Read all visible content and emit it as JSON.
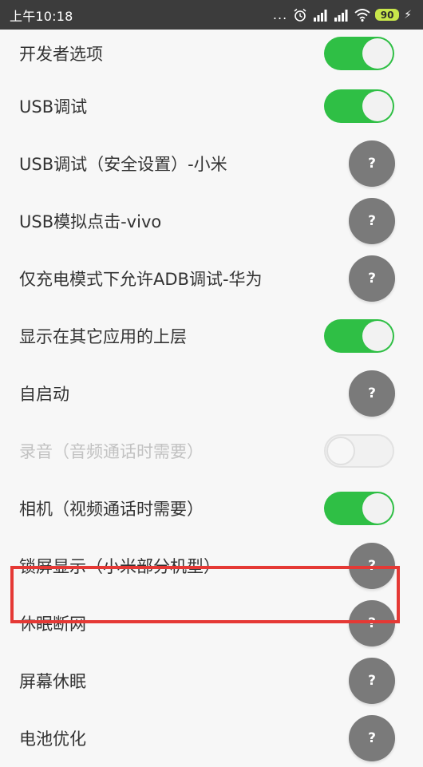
{
  "status_bar": {
    "time": "上午10:18",
    "dots": "...",
    "battery": "90",
    "icons": [
      "alarm-icon",
      "signal-icon",
      "signal-icon",
      "wifi-icon",
      "battery-icon",
      "charging-icon"
    ]
  },
  "colors": {
    "toggle_on": "#2fbf45",
    "help_button": "#7a7a7a",
    "highlight": "#e53935",
    "disabled_text": "#c2c2c2"
  },
  "items": [
    {
      "label": "开发者选项",
      "control": "toggle",
      "state": "on"
    },
    {
      "label": "USB调试",
      "control": "toggle",
      "state": "on"
    },
    {
      "label": "USB调试（安全设置）-小米",
      "control": "help",
      "symbol": "?"
    },
    {
      "label": "USB模拟点击-vivo",
      "control": "help",
      "symbol": "?"
    },
    {
      "label": "仅充电模式下允许ADB调试-华为",
      "control": "help",
      "symbol": "?"
    },
    {
      "label": "显示在其它应用的上层",
      "control": "toggle",
      "state": "on"
    },
    {
      "label": "自启动",
      "control": "help",
      "symbol": "?"
    },
    {
      "label": "录音（音频通话时需要）",
      "control": "toggle",
      "state": "off",
      "disabled": true
    },
    {
      "label": "相机（视频通话时需要）",
      "control": "toggle",
      "state": "on"
    },
    {
      "label": "锁屏显示（小米部分机型）",
      "control": "help",
      "symbol": "?"
    },
    {
      "label": "休眠断网",
      "control": "help",
      "symbol": "?",
      "highlighted": true
    },
    {
      "label": "屏幕休眠",
      "control": "help",
      "symbol": "?"
    },
    {
      "label": "电池优化",
      "control": "help",
      "symbol": "?"
    }
  ]
}
